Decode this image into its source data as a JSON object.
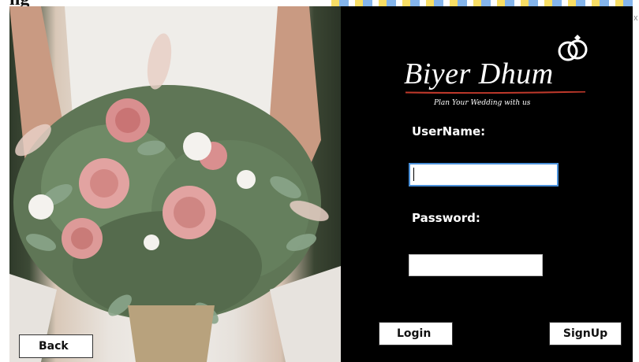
{
  "app": {
    "brand": "Biyer Dhum",
    "tagline": "Plan Your Wedding with us",
    "partial_title": "ng"
  },
  "form": {
    "username_label": "UserName:",
    "password_label": "Password:",
    "username_value": "",
    "password_value": ""
  },
  "buttons": {
    "login": "Login",
    "signup": "SignUp",
    "back": "Back"
  },
  "window": {
    "close_glyph": "x"
  },
  "colors": {
    "panel": "#000000",
    "accent_underline": "#c0392b",
    "focus_border": "#4a90d9"
  },
  "icons": {
    "logo": "wedding-rings-icon",
    "photo": "bridal-bouquet-photo"
  }
}
